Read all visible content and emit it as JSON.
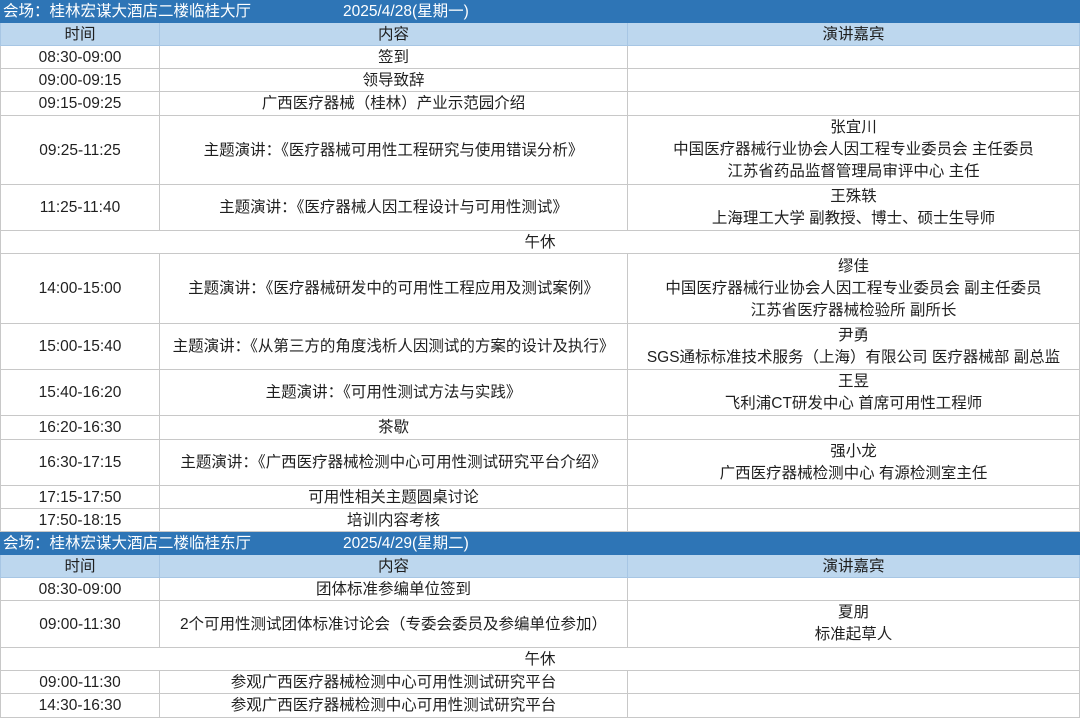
{
  "sessions": [
    {
      "venue": "会场：桂林宏谋大酒店二楼临桂大厅",
      "date": "2025/4/28(星期一)",
      "columns": {
        "time": "时间",
        "content": "内容",
        "speakers": "演讲嘉宾"
      },
      "rows": [
        {
          "time": "08:30-09:00",
          "content": "签到"
        },
        {
          "time": "09:00-09:15",
          "content": "领导致辞"
        },
        {
          "time": "09:15-09:25",
          "content": "广西医疗器械（桂林）产业示范园介绍"
        },
        {
          "time": "09:25-11:25",
          "content": "主题演讲：《医疗器械可用性工程研究与使用错误分析》",
          "speaker": {
            "name": "张宜川",
            "titles": [
              "中国医疗器械行业协会人因工程专业委员会 主任委员",
              "江苏省药品监督管理局审评中心 主任"
            ]
          }
        },
        {
          "time": "11:25-11:40",
          "content": "主题演讲：《医疗器械人因工程设计与可用性测试》",
          "speaker": {
            "name": "王殊轶",
            "titles": [
              "上海理工大学 副教授、博士、硕士生导师"
            ]
          }
        },
        {
          "break": "午休"
        },
        {
          "time": "14:00-15:00",
          "content": "主题演讲：《医疗器械研发中的可用性工程应用及测试案例》",
          "speaker": {
            "name": "缪佳",
            "titles": [
              "中国医疗器械行业协会人因工程专业委员会 副主任委员",
              "江苏省医疗器械检验所 副所长"
            ]
          }
        },
        {
          "time": "15:00-15:40",
          "content": "主题演讲：《从第三方的角度浅析人因测试的方案的设计及执行》",
          "speaker": {
            "name": "尹勇",
            "titles": [
              "SGS通标标准技术服务（上海）有限公司 医疗器械部 副总监"
            ]
          }
        },
        {
          "time": "15:40-16:20",
          "content": "主题演讲：《可用性测试方法与实践》",
          "speaker": {
            "name": "王昱",
            "titles": [
              "飞利浦CT研发中心 首席可用性工程师"
            ]
          }
        },
        {
          "time": "16:20-16:30",
          "content": "茶歇"
        },
        {
          "time": "16:30-17:15",
          "content": "主题演讲：《广西医疗器械检测中心可用性测试研究平台介绍》",
          "speaker": {
            "name": "强小龙",
            "titles": [
              "广西医疗器械检测中心 有源检测室主任"
            ]
          }
        },
        {
          "time": "17:15-17:50",
          "content": "可用性相关主题圆桌讨论"
        },
        {
          "time": "17:50-18:15",
          "content": "培训内容考核"
        }
      ]
    },
    {
      "venue": "会场：桂林宏谋大酒店二楼临桂东厅",
      "date": "2025/4/29(星期二)",
      "columns": {
        "time": "时间",
        "content": "内容",
        "speakers": "演讲嘉宾"
      },
      "rows": [
        {
          "time": "08:30-09:00",
          "content": "团体标准参编单位签到"
        },
        {
          "time": "09:00-11:30",
          "content": "2个可用性测试团体标准讨论会（专委会委员及参编单位参加）",
          "speaker": {
            "name": "夏朋",
            "titles": [
              "标准起草人"
            ]
          }
        },
        {
          "break": "午休"
        },
        {
          "time": "09:00-11:30",
          "content": "参观广西医疗器械检测中心可用性测试研究平台"
        },
        {
          "time": "14:30-16:30",
          "content": "参观广西医疗器械检测中心可用性测试研究平台"
        }
      ]
    }
  ],
  "colors": {
    "venue_bar": "#2e75b6",
    "column_header": "#bdd7ee",
    "grid_line": "#c8c8c8",
    "text": "#1f1f1f"
  }
}
